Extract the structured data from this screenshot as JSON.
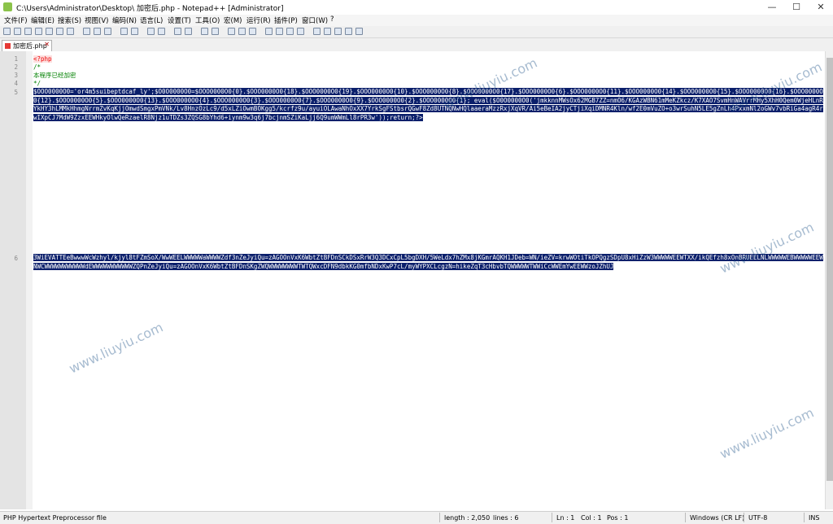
{
  "window": {
    "title": "C:\\Users\\Administrator\\Desktop\\          加密后.php - Notepad++ [Administrator]",
    "minimize": "—",
    "maximize": "☐",
    "close": "✕"
  },
  "menu": [
    "文件(F)",
    "编辑(E)",
    "搜索(S)",
    "视图(V)",
    "编码(N)",
    "语言(L)",
    "设置(T)",
    "工具(O)",
    "宏(M)",
    "运行(R)",
    "插件(P)",
    "窗口(W)",
    "?"
  ],
  "tab": {
    "label": "加密后.php"
  },
  "editor": {
    "line_numbers": [
      "1",
      "2",
      "3",
      "4",
      "5",
      "6"
    ],
    "lines": {
      "l1": "<?php",
      "l2": "/*",
      "l3": "本程序已经加密",
      "l4": "*/"
    },
    "line5_text": "$OOO0000O0='or4m5suibeptdcaf_ly';$O0O0000O0=$OOO0000O0{0}.$OOO0000O0{18}.$OOO0000O0{19}.$OOO0000O0{10}.$OOO0000O0{8}.$OOO0000O0{17}.$OOO0000O0{6}.$OOO0000O0{11}.$OOO0000O0{14}.$OOO0000O0{15}.$OOO0000O0{16}.$OOO0000O0{12}.$OOO0000O0{5}.$OOO0000O0{13}.$OOO0000O0{4}.$OOO0000O0{3}.$OOO0000O0{7}.$OOO0000O0{9}.$OOO0000O0{2}.$OOO0000O0{1}; eval($O0O0000O0('jmkknnMWsOx62MGB7ZZ=nmO6/KGAzWBN61mMeKZkcz/K7XAO7SvmHnWAVrrMHy5XhH0Qem0WjeHLnRYkHY3hLMMkHhmgNrrmZvKqKjjOmwdSmgxPmVNk/Lv8HnzOzLc9/d5xLZiOwmBOKgg5/kcrfz9u/ayuiOLAwaNhOxXX7YrkSgFStbsrQGwF8Zd8UTNQNwHQlaaeraMzzRxjXqVR/Ai5eBeIA2jyCTjiXqiDMNR4Kln/wf2E0mVuZO+o3wrSuhN5LE5gZnLh4PxxmNl2oGWv7vbRiGa4agR4rwIXpCJ7MdW9ZzxEEWHkyOlwQeRzaelR8Njz1uTDZs3ZQSG8bYhd6+iynm9w3q6j7bcjnmSZiKaLjj6Q9umWWmLl8rPR3w'));return;?>",
    "line6_text": "3WiEVATTEeBwwwWcWzhyl/kjyl8tFZmSoX/WwWEELWWWWWaWWWWZdf3nZeJyiQu=zAGOOnVxK6WbtZtBFDnSCkDSxRrW3Q3DCxCpL5bgDXH/5WeLdx7hZMx8jKGmrAQKH1JDeb=WN/ieZV=krwWOtiTkOPQgzSDpU8xHiZzW3WWWWWEEWTXX/ikQEfzh8xOnBRUEELNLWWWWWEBWWWWWEEWNWCWWWWWWWWWWWdEWWWWWWWWWWWZQPnZeJyiQu=zAGOOnVxK6WbtZtBFDnSKgZWQWWWWWWWWTWTQWxcDFN9dbkKG0mfbNDxKwP7cL/myWYPXCLcgzN=hikeZqT3cHbvbTQWWWWWTWWiCcWWEmYwEEWWzoJZhUJ"
  },
  "watermark": "www.liuyiu.com",
  "status": {
    "file_type": "PHP Hypertext Preprocessor file",
    "length": "length : 2,050",
    "lines": "lines : 6",
    "ln": "Ln : 1",
    "col": "Col : 1",
    "pos": "Pos : 1",
    "eol": "Windows (CR LF)",
    "encoding": "UTF-8",
    "mode": "INS"
  }
}
